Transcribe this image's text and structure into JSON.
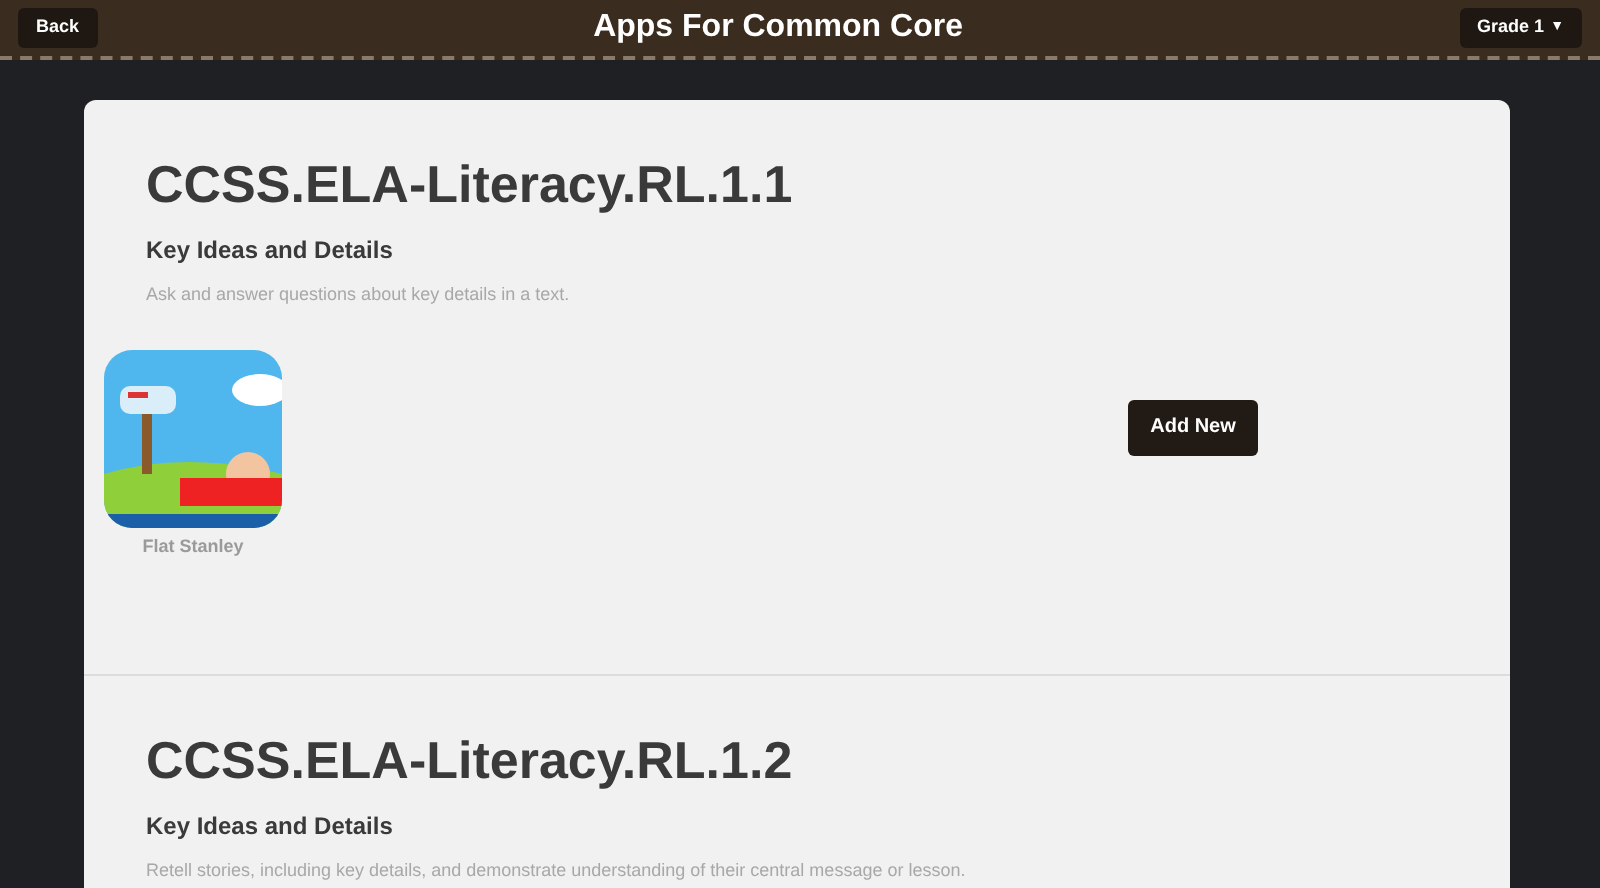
{
  "header": {
    "back_button": "Back",
    "title": "Apps For Common Core",
    "grade_button": "Grade 1",
    "grade_caret": "▼"
  },
  "standards": [
    {
      "code": "CCSS.ELA-Literacy.RL.1.1",
      "subtitle": "Key Ideas and Details",
      "description": "Ask and answer questions about key details in a text.",
      "apps": [
        {
          "name": "Flat Stanley"
        }
      ],
      "add_button": "Add New"
    },
    {
      "code": "CCSS.ELA-Literacy.RL.1.2",
      "subtitle": "Key Ideas and Details",
      "description": "Retell stories, including key details, and demonstrate understanding of their central message or lesson."
    }
  ]
}
